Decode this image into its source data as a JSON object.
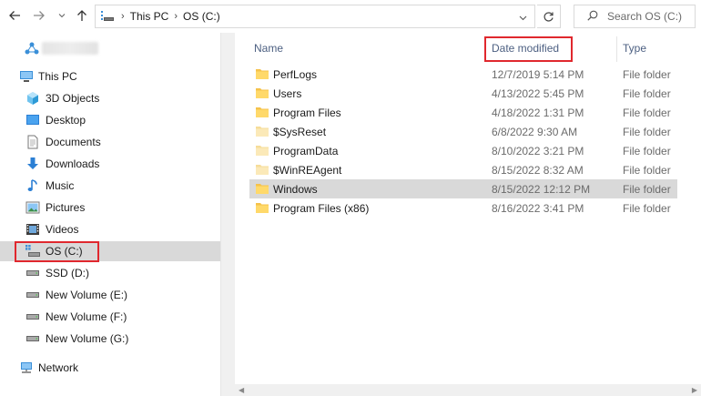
{
  "address": {
    "breadcrumbs": [
      "This PC",
      "OS (C:)"
    ]
  },
  "search": {
    "placeholder": "Search OS (C:)"
  },
  "nav": {
    "this_pc": "This PC",
    "items": [
      {
        "label": "3D Objects",
        "icon": "3d-objects-icon"
      },
      {
        "label": "Desktop",
        "icon": "desktop-icon"
      },
      {
        "label": "Documents",
        "icon": "documents-icon"
      },
      {
        "label": "Downloads",
        "icon": "downloads-icon"
      },
      {
        "label": "Music",
        "icon": "music-icon"
      },
      {
        "label": "Pictures",
        "icon": "pictures-icon"
      },
      {
        "label": "Videos",
        "icon": "videos-icon"
      },
      {
        "label": "OS (C:)",
        "icon": "os-drive-icon"
      },
      {
        "label": "SSD (D:)",
        "icon": "drive-icon"
      },
      {
        "label": "New Volume (E:)",
        "icon": "drive-icon"
      },
      {
        "label": "New Volume (F:)",
        "icon": "drive-icon"
      },
      {
        "label": "New Volume (G:)",
        "icon": "drive-icon"
      }
    ],
    "network": "Network"
  },
  "columns": {
    "name": "Name",
    "date": "Date modified",
    "type": "Type"
  },
  "files": [
    {
      "name": "PerfLogs",
      "date": "12/7/2019 5:14 PM",
      "type": "File folder",
      "hidden": false
    },
    {
      "name": "Users",
      "date": "4/13/2022 5:45 PM",
      "type": "File folder",
      "hidden": false
    },
    {
      "name": "Program Files",
      "date": "4/18/2022 1:31 PM",
      "type": "File folder",
      "hidden": false
    },
    {
      "name": "$SysReset",
      "date": "6/8/2022 9:30 AM",
      "type": "File folder",
      "hidden": true
    },
    {
      "name": "ProgramData",
      "date": "8/10/2022 3:21 PM",
      "type": "File folder",
      "hidden": true
    },
    {
      "name": "$WinREAgent",
      "date": "8/15/2022 8:32 AM",
      "type": "File folder",
      "hidden": true
    },
    {
      "name": "Windows",
      "date": "8/15/2022 12:12 PM",
      "type": "File folder",
      "hidden": false
    },
    {
      "name": "Program Files (x86)",
      "date": "8/16/2022 3:41 PM",
      "type": "File folder",
      "hidden": false
    }
  ],
  "colors": {
    "accent_highlight": "#e0282e",
    "selection": "#d9d9d9",
    "header_text": "#4d6082",
    "folder": "#f5c24b",
    "folder_hidden": "#f9e2a8"
  }
}
